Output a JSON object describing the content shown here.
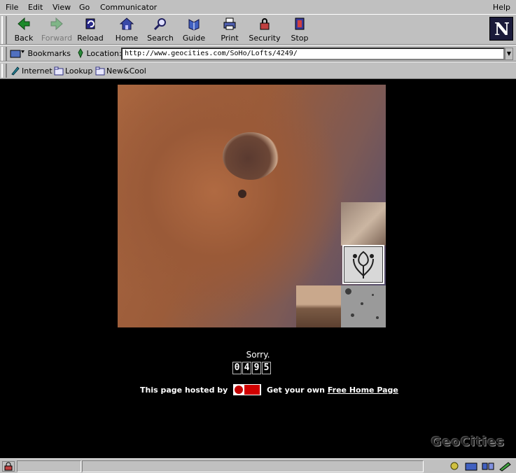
{
  "menu": {
    "file": "File",
    "edit": "Edit",
    "view": "View",
    "go": "Go",
    "communicator": "Communicator",
    "help": "Help"
  },
  "toolbar": {
    "back": "Back",
    "forward": "Forward",
    "reload": "Reload",
    "home": "Home",
    "search": "Search",
    "guide": "Guide",
    "print": "Print",
    "security": "Security",
    "stop": "Stop"
  },
  "location": {
    "bookmarks_label": "Bookmarks",
    "location_label": "Location:",
    "url": "http://www.geocities.com/SoHo/Lofts/4249/"
  },
  "personal": {
    "internet": "Internet",
    "lookup": "Lookup",
    "new_cool": "New&Cool"
  },
  "page": {
    "sorry": "Sorry.",
    "counter_digits": [
      "0",
      "4",
      "9",
      "5"
    ],
    "hosted_prefix": "This page hosted by",
    "hosted_middle": "Get your own",
    "free_home_page": "Free Home Page",
    "brand_logo": "GeoCities"
  },
  "icons": {
    "back": "back-arrow-icon",
    "forward": "forward-arrow-icon",
    "reload": "reload-icon",
    "home": "home-icon",
    "search": "search-icon",
    "guide": "guide-icon",
    "print": "printer-icon",
    "security": "lock-icon",
    "stop": "stop-icon"
  },
  "colors": {
    "chrome": "#c0c0c0",
    "page_background": "#000000",
    "mars_orange": "#a9663f",
    "mars_blue": "#4b4a72"
  }
}
